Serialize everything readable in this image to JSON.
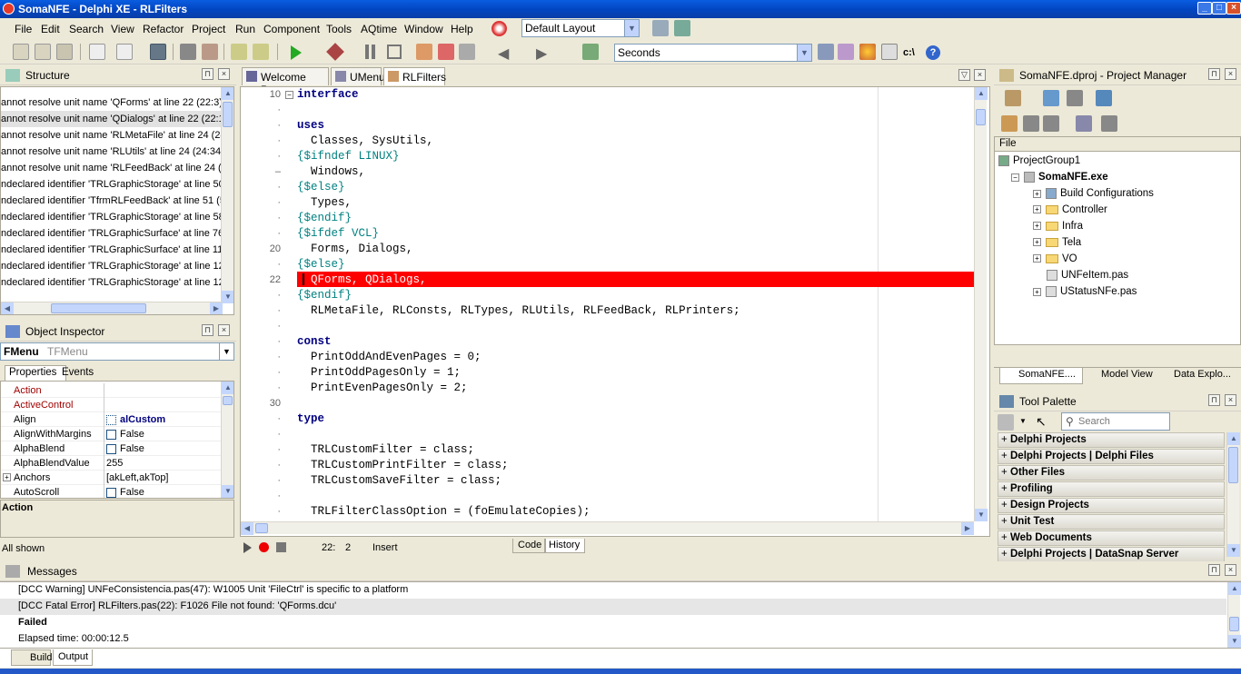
{
  "window": {
    "title": "SomaNFE - Delphi XE - RLFilters",
    "buttons": [
      "_",
      "□",
      "×"
    ]
  },
  "menu": [
    "File",
    "Edit",
    "Search",
    "View",
    "Refactor",
    "Project",
    "Run",
    "Component",
    "Tools",
    "AQtime",
    "Window",
    "Help"
  ],
  "layout_combo": "Default Layout",
  "units_combo": "Seconds",
  "structure": {
    "title": "Structure",
    "items": [
      "annot resolve unit name 'QForms' at line 22 (22:3)",
      "annot resolve unit name 'QDialogs' at line 22 (22:1:",
      "annot resolve unit name 'RLMetaFile' at line 24 (24:",
      "annot resolve unit name 'RLUtils' at line 24 (24:34)",
      "annot resolve unit name 'RLFeedBack' at line 24 (2…",
      "ndeclared identifier 'TRLGraphicStorage' at line 50 (",
      "ndeclared identifier 'TfrmRLFeedBack' at line 51 (51",
      "ndeclared identifier 'TRLGraphicStorage' at line 58 (",
      "ndeclared identifier 'TRLGraphicSurface' at line 76 (",
      "ndeclared identifier 'TRLGraphicSurface' at line 115",
      "ndeclared identifier 'TRLGraphicStorage' at line 122",
      "ndeclared identifier 'TRLGraphicStorage' at line 123"
    ]
  },
  "object_inspector": {
    "title": "Object Inspector",
    "object_name": "FMenu",
    "object_type": "TFMenu",
    "tabs": [
      "Properties",
      "Events"
    ],
    "rows": [
      {
        "name": "Action",
        "value": "",
        "check": false
      },
      {
        "name": "ActiveControl",
        "value": "",
        "check": false
      },
      {
        "name": "Align",
        "value": "alCustom",
        "check": false
      },
      {
        "name": "AlignWithMargins",
        "value": "False",
        "check": true
      },
      {
        "name": "AlphaBlend",
        "value": "False",
        "check": true
      },
      {
        "name": "AlphaBlendValue",
        "value": "255",
        "check": false
      },
      {
        "name": "Anchors",
        "value": "[akLeft,akTop]",
        "check": false
      },
      {
        "name": "AutoScroll",
        "value": "False",
        "check": true
      }
    ],
    "description": "Action",
    "status": "All shown"
  },
  "editor": {
    "tabs": [
      "Welcome Page",
      "UMenu",
      "RLFilters"
    ],
    "line_numbers": [
      "10",
      "",
      "",
      "",
      "",
      "",
      "",
      "",
      "",
      "",
      "20",
      "",
      "22",
      "",
      "",
      "",
      "",
      "",
      "",
      "",
      "30"
    ],
    "lines": [
      "interface",
      "",
      "uses",
      "  Classes, SysUtils,",
      "{$ifndef LINUX}",
      "  Windows,",
      "{$else}",
      "  Types,",
      "{$endif}",
      "{$ifdef VCL}",
      "  Forms, Dialogs,",
      "{$else}",
      "  QForms, QDialogs,",
      "{$endif}",
      "  RLMetaFile, RLConsts, RLTypes, RLUtils, RLFeedBack, RLPrinters;",
      "",
      "const",
      "  PrintOddAndEvenPages = 0;",
      "  PrintOddPagesOnly = 1;",
      "  PrintEvenPagesOnly = 2;",
      "",
      "type",
      "",
      "  TRLCustomFilter = class;",
      "  TRLCustomPrintFilter = class;",
      "  TRLCustomSaveFilter = class;",
      "",
      "  TRLFilterClassOption = (foEmulateCopies);"
    ],
    "status": {
      "line": "22:",
      "col": "2",
      "mode": "Insert"
    },
    "bottom_tabs": [
      "Code",
      "History"
    ]
  },
  "project_manager": {
    "title": "SomaNFE.dproj - Project Manager",
    "column": "File",
    "tree": [
      {
        "label": "ProjectGroup1",
        "level": 0,
        "kind": "group"
      },
      {
        "label": "SomaNFE.exe",
        "level": 1,
        "kind": "exe"
      },
      {
        "label": "Build Configurations",
        "level": 2,
        "kind": "config"
      },
      {
        "label": "Controller",
        "level": 2,
        "kind": "folder"
      },
      {
        "label": "Infra",
        "level": 2,
        "kind": "folder"
      },
      {
        "label": "Tela",
        "level": 2,
        "kind": "folder"
      },
      {
        "label": "VO",
        "level": 2,
        "kind": "folder"
      },
      {
        "label": "UNFeItem.pas",
        "level": 2,
        "kind": "file"
      },
      {
        "label": "UStatusNFe.pas",
        "level": 2,
        "kind": "file"
      }
    ],
    "bottom_tabs": [
      "SomaNFE....",
      "Model View",
      "Data Explo..."
    ]
  },
  "tool_palette": {
    "title": "Tool Palette",
    "search_placeholder": "Search",
    "categories": [
      "Delphi Projects",
      "Delphi Projects | Delphi Files",
      "Other Files",
      "Profiling",
      "Design Projects",
      "Unit Test",
      "Web Documents",
      "Delphi Projects | DataSnap Server"
    ]
  },
  "messages": {
    "title": "Messages",
    "items": [
      "[DCC Warning] UNFeConsistencia.pas(47): W1005 Unit 'FileCtrl' is specific to a platform",
      "[DCC Fatal Error] RLFilters.pas(22): F1026 File not found: 'QForms.dcu'",
      "Failed",
      "Elapsed time: 00:00:12.5"
    ],
    "tabs": [
      "Build",
      "Output"
    ]
  },
  "colors": {
    "error_line": "#ff0000",
    "keyword": "#000080",
    "directive": "#008080",
    "titlebar": "#0a5de0"
  }
}
